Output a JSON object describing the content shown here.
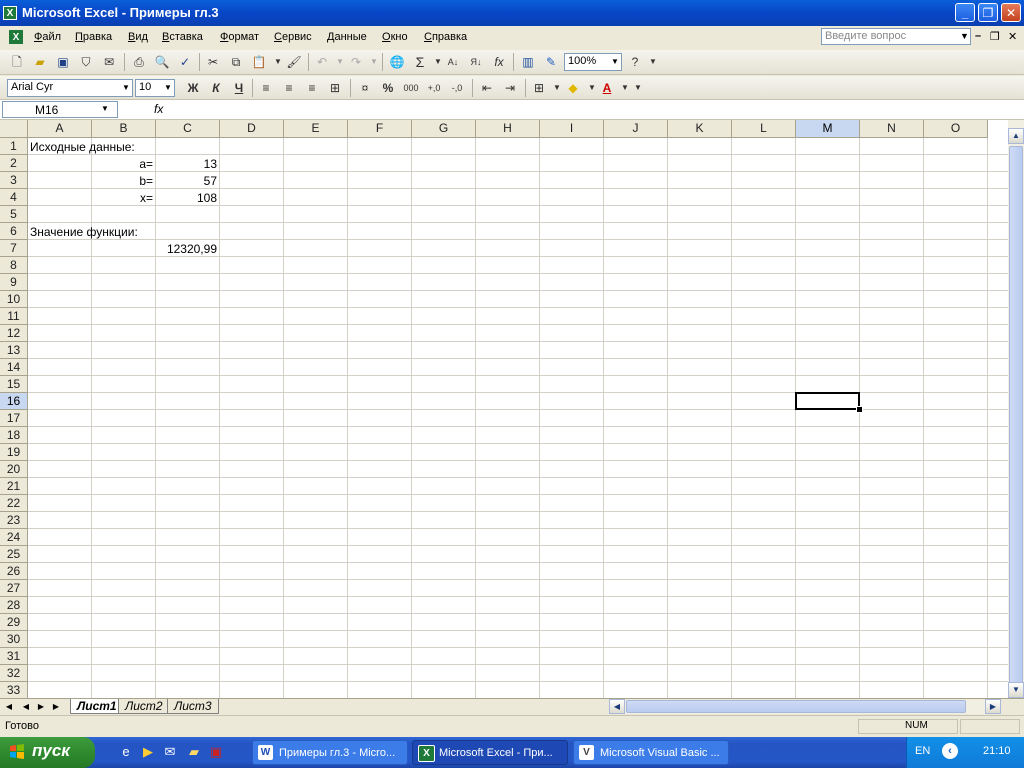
{
  "window": {
    "title": "Microsoft Excel - Примеры гл.3",
    "app_icon_letter": "X"
  },
  "menu": {
    "items": [
      "Файл",
      "Правка",
      "Вид",
      "Вставка",
      "Формат",
      "Сервис",
      "Данные",
      "Окно",
      "Справка"
    ],
    "help_placeholder": "Введите вопрос"
  },
  "toolbar_standard": {
    "zoom": "100%"
  },
  "toolbar_format": {
    "font_name": "Arial Cyr",
    "font_size": "10",
    "bold": "Ж",
    "italic": "К",
    "underline": "Ч",
    "percent": "%",
    "thousands": "000"
  },
  "formula_bar": {
    "name_box": "M16",
    "fx": "fx",
    "content": ""
  },
  "sheet": {
    "columns": [
      "A",
      "B",
      "C",
      "D",
      "E",
      "F",
      "G",
      "H",
      "I",
      "J",
      "K",
      "L",
      "M",
      "N",
      "O"
    ],
    "rows": [
      "1",
      "2",
      "3",
      "4",
      "5",
      "6",
      "7",
      "8",
      "9",
      "10",
      "11",
      "12",
      "13",
      "14",
      "15",
      "16",
      "17",
      "18",
      "19",
      "20",
      "21",
      "22",
      "23",
      "24",
      "25",
      "26",
      "27",
      "28",
      "29",
      "30",
      "31",
      "32",
      "33"
    ],
    "selected_cell": "M16",
    "cells": {
      "a1": "Исходные данные:",
      "b2": "a=",
      "c2": "13",
      "b3": "b=",
      "c3": "57",
      "b4": "x=",
      "c4": "108",
      "a6": "Значение функции:",
      "c7": "12320,99"
    }
  },
  "sheet_tabs": [
    "Лист1",
    "Лист2",
    "Лист3"
  ],
  "status": {
    "left": "Готово",
    "num": "NUM"
  },
  "taskbar": {
    "start_label": "пуск",
    "tasks": [
      {
        "label": "Примеры гл.3 - Micro..."
      },
      {
        "label": "Microsoft Excel - При..."
      },
      {
        "label": "Microsoft Visual Basic ..."
      }
    ],
    "language": "EN",
    "clock": "21:10"
  },
  "colors": {
    "titlebar": "#0a5fd8",
    "taskbar": "#2456c7",
    "start_button": "#2f8a2f",
    "selected_header": "#c8d8f0"
  }
}
